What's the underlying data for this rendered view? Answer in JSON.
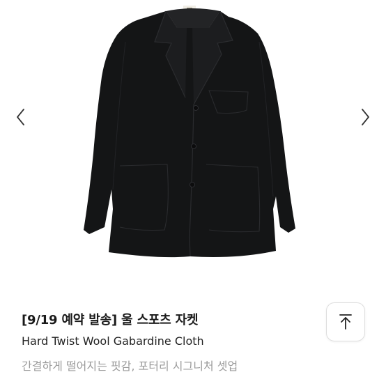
{
  "product": {
    "title": "[9/19 예약 발송] 울 스포츠 자켓",
    "subtitle": "Hard Twist Wool Gabardine Cloth",
    "description": "간결하게 떨어지는 핏감, 포터리 시그니처 셋업"
  },
  "gallery": {
    "image": "black-wool-sport-jacket",
    "prev_icon": "chevron-left-icon",
    "next_icon": "chevron-right-icon"
  },
  "scroll_top": {
    "icon": "arrow-up-to-top-icon"
  },
  "colors": {
    "jacket": "#141516",
    "title_text": "#1a1a1a",
    "description_text": "#9b9b9b",
    "button_border": "#dedede"
  }
}
